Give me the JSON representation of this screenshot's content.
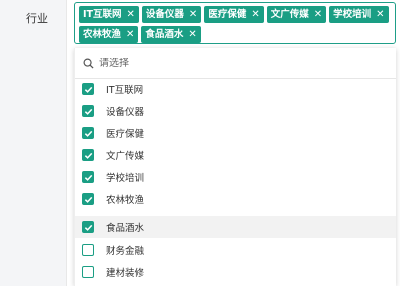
{
  "field": {
    "label": "行业"
  },
  "tags": [
    {
      "label": "IT互联网"
    },
    {
      "label": "设备仪器"
    },
    {
      "label": "医疗保健"
    },
    {
      "label": "文广传媒"
    },
    {
      "label": "学校培训"
    },
    {
      "label": "农林牧渔"
    },
    {
      "label": "食品酒水"
    }
  ],
  "dropdown": {
    "search_placeholder": "请选择",
    "options": [
      {
        "label": "IT互联网",
        "checked": true
      },
      {
        "label": "设备仪器",
        "checked": true
      },
      {
        "label": "医疗保健",
        "checked": true
      },
      {
        "label": "文广传媒",
        "checked": true
      },
      {
        "label": "学校培训",
        "checked": true
      },
      {
        "label": "农林牧渔",
        "checked": true
      },
      {
        "label": "食品酒水",
        "checked": true
      },
      {
        "label": "财务金融",
        "checked": false
      },
      {
        "label": "建材装修",
        "checked": false
      }
    ],
    "hovered_option": "食品酒水"
  },
  "colors": {
    "accent": "#1a9e84",
    "tag_text": "#ffffff",
    "hover_bg": "#f2f2f2"
  },
  "icons": {
    "search": "search-icon",
    "remove": "close-icon",
    "check": "check-icon"
  }
}
